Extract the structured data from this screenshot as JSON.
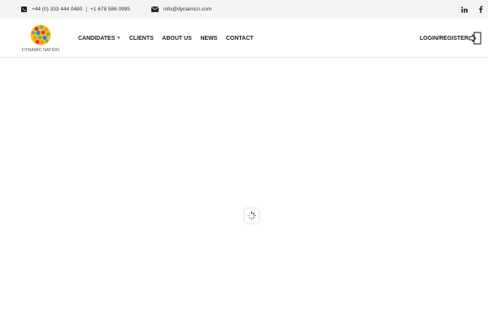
{
  "topbar": {
    "phone_icon": "phone-icon",
    "phone_primary": "+44 (0) 333 444 0480",
    "separator": "|",
    "phone_secondary": "+1 678 586 0995",
    "email_icon": "envelope-icon",
    "email": "info@dynamicn.com",
    "social": [
      {
        "icon": "linkedin-icon",
        "label": "in"
      },
      {
        "icon": "facebook-icon",
        "label": "f"
      }
    ]
  },
  "header": {
    "logo_text": "DYNAMIC NATION",
    "nav": [
      {
        "label": "CANDIDATES",
        "has_dropdown": true
      },
      {
        "label": "CLIENTS"
      },
      {
        "label": "ABOUT US"
      },
      {
        "label": "NEWS"
      },
      {
        "label": "CONTACT"
      }
    ],
    "login_label": "LOGIN/REGISTER",
    "login_icon": "sign-in-icon"
  },
  "main": {
    "loader_icon": "spinner-icon"
  },
  "colors": {
    "topbar_bg": "#f4f4f4",
    "text_dark": "#1b1b1b",
    "logo_red": "#e5342d",
    "logo_orange": "#f39a1e",
    "logo_green": "#7cb342",
    "logo_yellow": "#fbc02d",
    "logo_blue": "#1e88e5"
  }
}
